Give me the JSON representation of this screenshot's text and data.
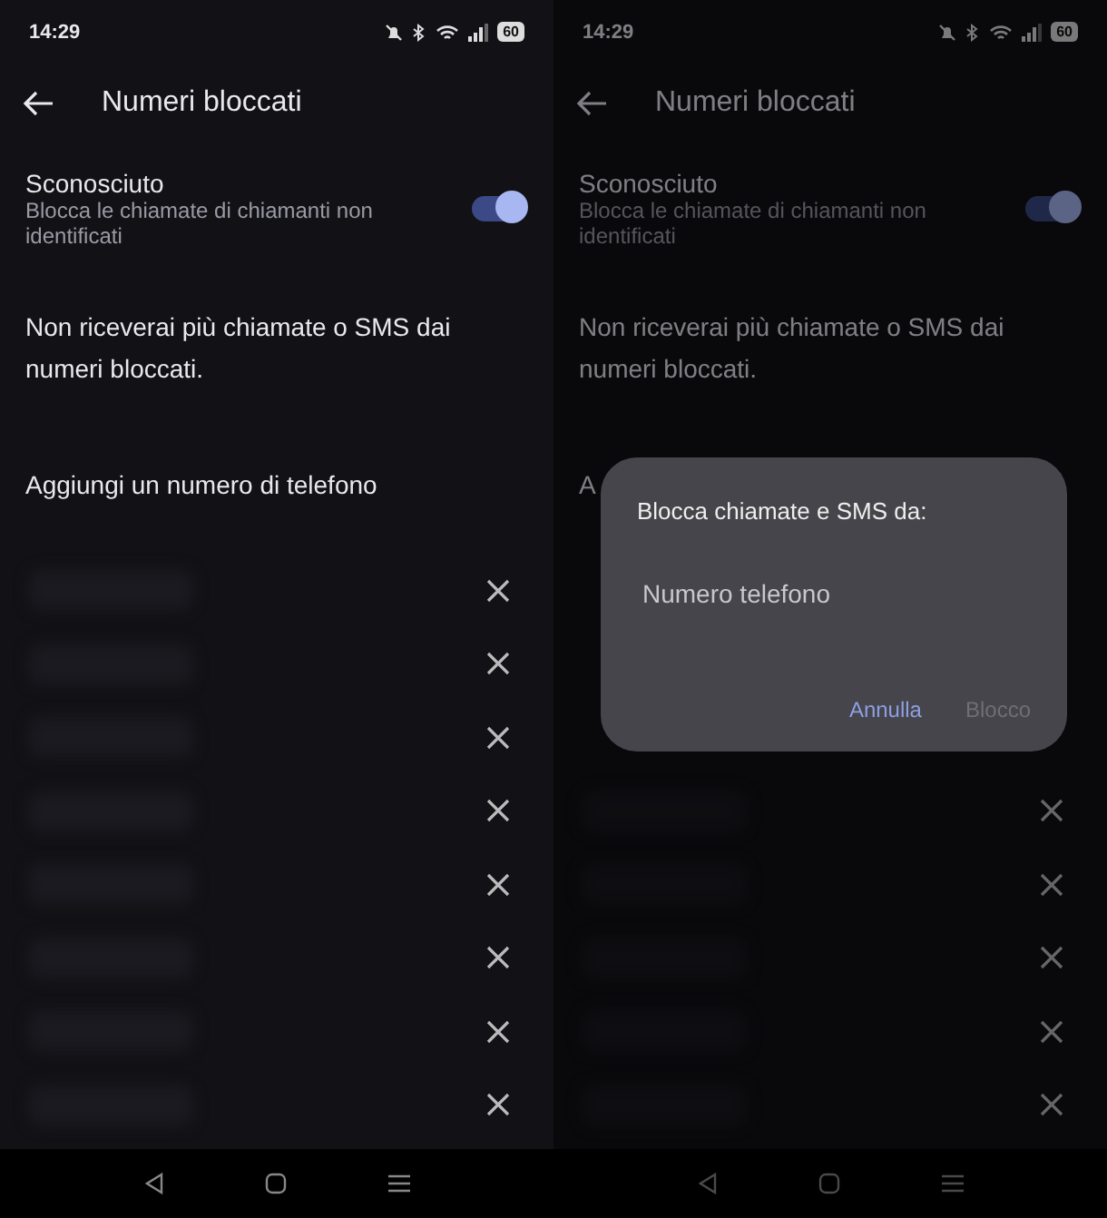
{
  "screens": [
    {
      "status_bar": {
        "time": "14:29",
        "battery": "60"
      },
      "title": "Numeri bloccati",
      "unknown_setting": {
        "label": "Sconosciuto",
        "description": "Blocca le chiamate di chiamanti non identificati",
        "on": true
      },
      "notice": "Non riceverai più chiamate o SMS dai numeri bloccati.",
      "add_number": "Aggiungi un numero di telefono",
      "blocked_numbers": [
        {
          "kind": "redacted"
        },
        {
          "kind": "redacted"
        },
        {
          "kind": "redacted"
        },
        {
          "kind": "redacted"
        },
        {
          "kind": "redacted"
        },
        {
          "kind": "redacted"
        },
        {
          "kind": "redacted"
        },
        {
          "kind": "redacted"
        }
      ]
    },
    {
      "status_bar": {
        "time": "14:29",
        "battery": "60"
      },
      "title": "Numeri bloccati",
      "unknown_setting": {
        "label": "Sconosciuto",
        "description": "Blocca le chiamate di chiamanti non identificati",
        "on": true
      },
      "notice": "Non riceverai più chiamate o SMS dai numeri bloccati.",
      "add_number": "A",
      "blocked_numbers": [
        {
          "kind": "covered"
        },
        {
          "kind": "covered"
        },
        {
          "kind": "covered"
        },
        {
          "kind": "redacted"
        },
        {
          "kind": "redacted"
        },
        {
          "kind": "redacted"
        },
        {
          "kind": "redacted"
        },
        {
          "kind": "redacted"
        }
      ],
      "dialog": {
        "title": "Blocca chiamate e SMS da:",
        "field": {
          "placeholder": "Numero telefono"
        },
        "buttons": [
          {
            "label": "Annulla",
            "disabled": false
          },
          {
            "label": "Blocco",
            "disabled": true
          }
        ]
      }
    }
  ]
}
